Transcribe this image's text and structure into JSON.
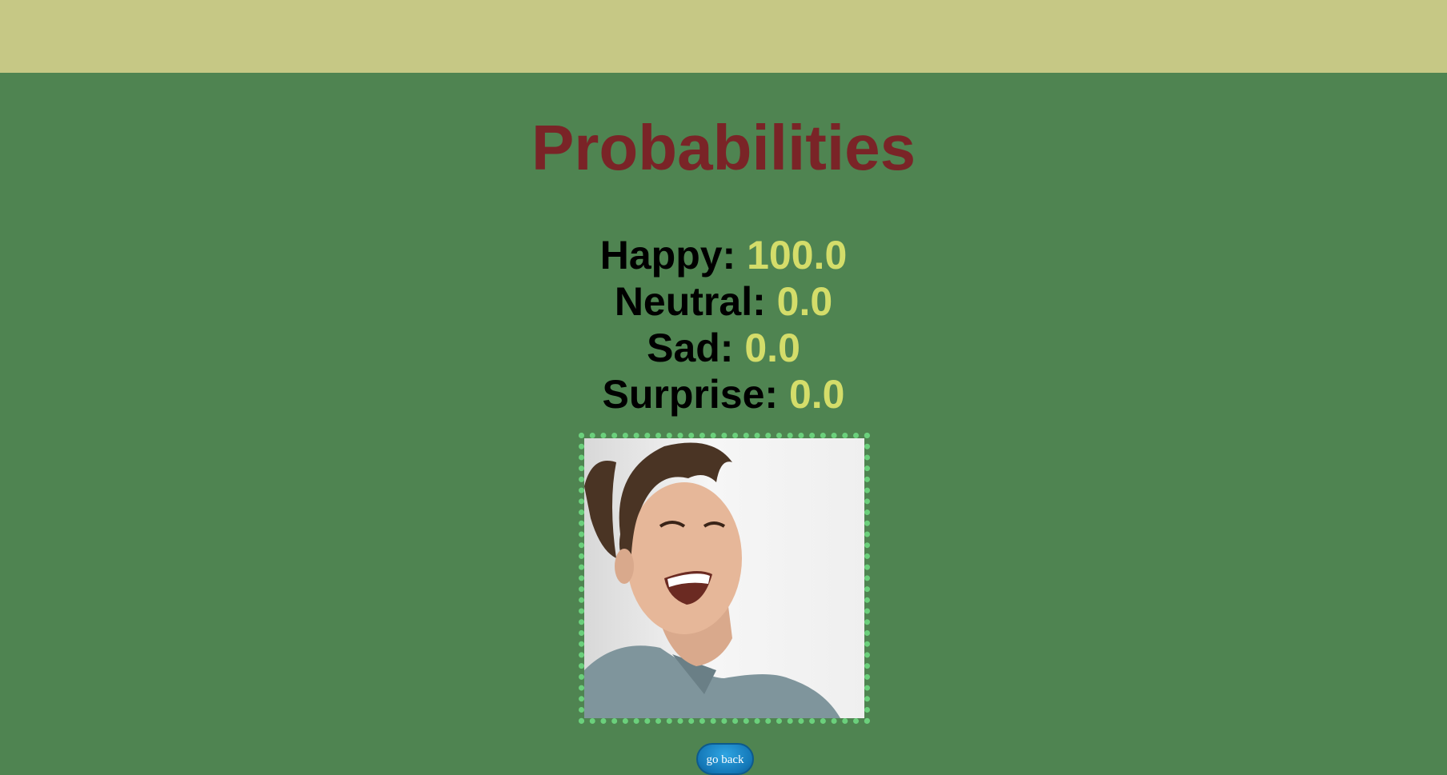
{
  "page": {
    "title": "Probabilities"
  },
  "probabilities": [
    {
      "label": "Happy:",
      "value": "100.0"
    },
    {
      "label": "Neutral:",
      "value": "0.0"
    },
    {
      "label": "Sad:",
      "value": "0.0"
    },
    {
      "label": "Surprise:",
      "value": "0.0"
    }
  ],
  "photo": {
    "description_icon": "person-photo"
  },
  "actions": {
    "back_label": "go back"
  },
  "colors": {
    "topbar": "#c6c885",
    "background": "#4f8451",
    "title": "#7a2427",
    "value": "#d4dd6a",
    "frame": "#6bd07c",
    "button": "#1478b8"
  }
}
